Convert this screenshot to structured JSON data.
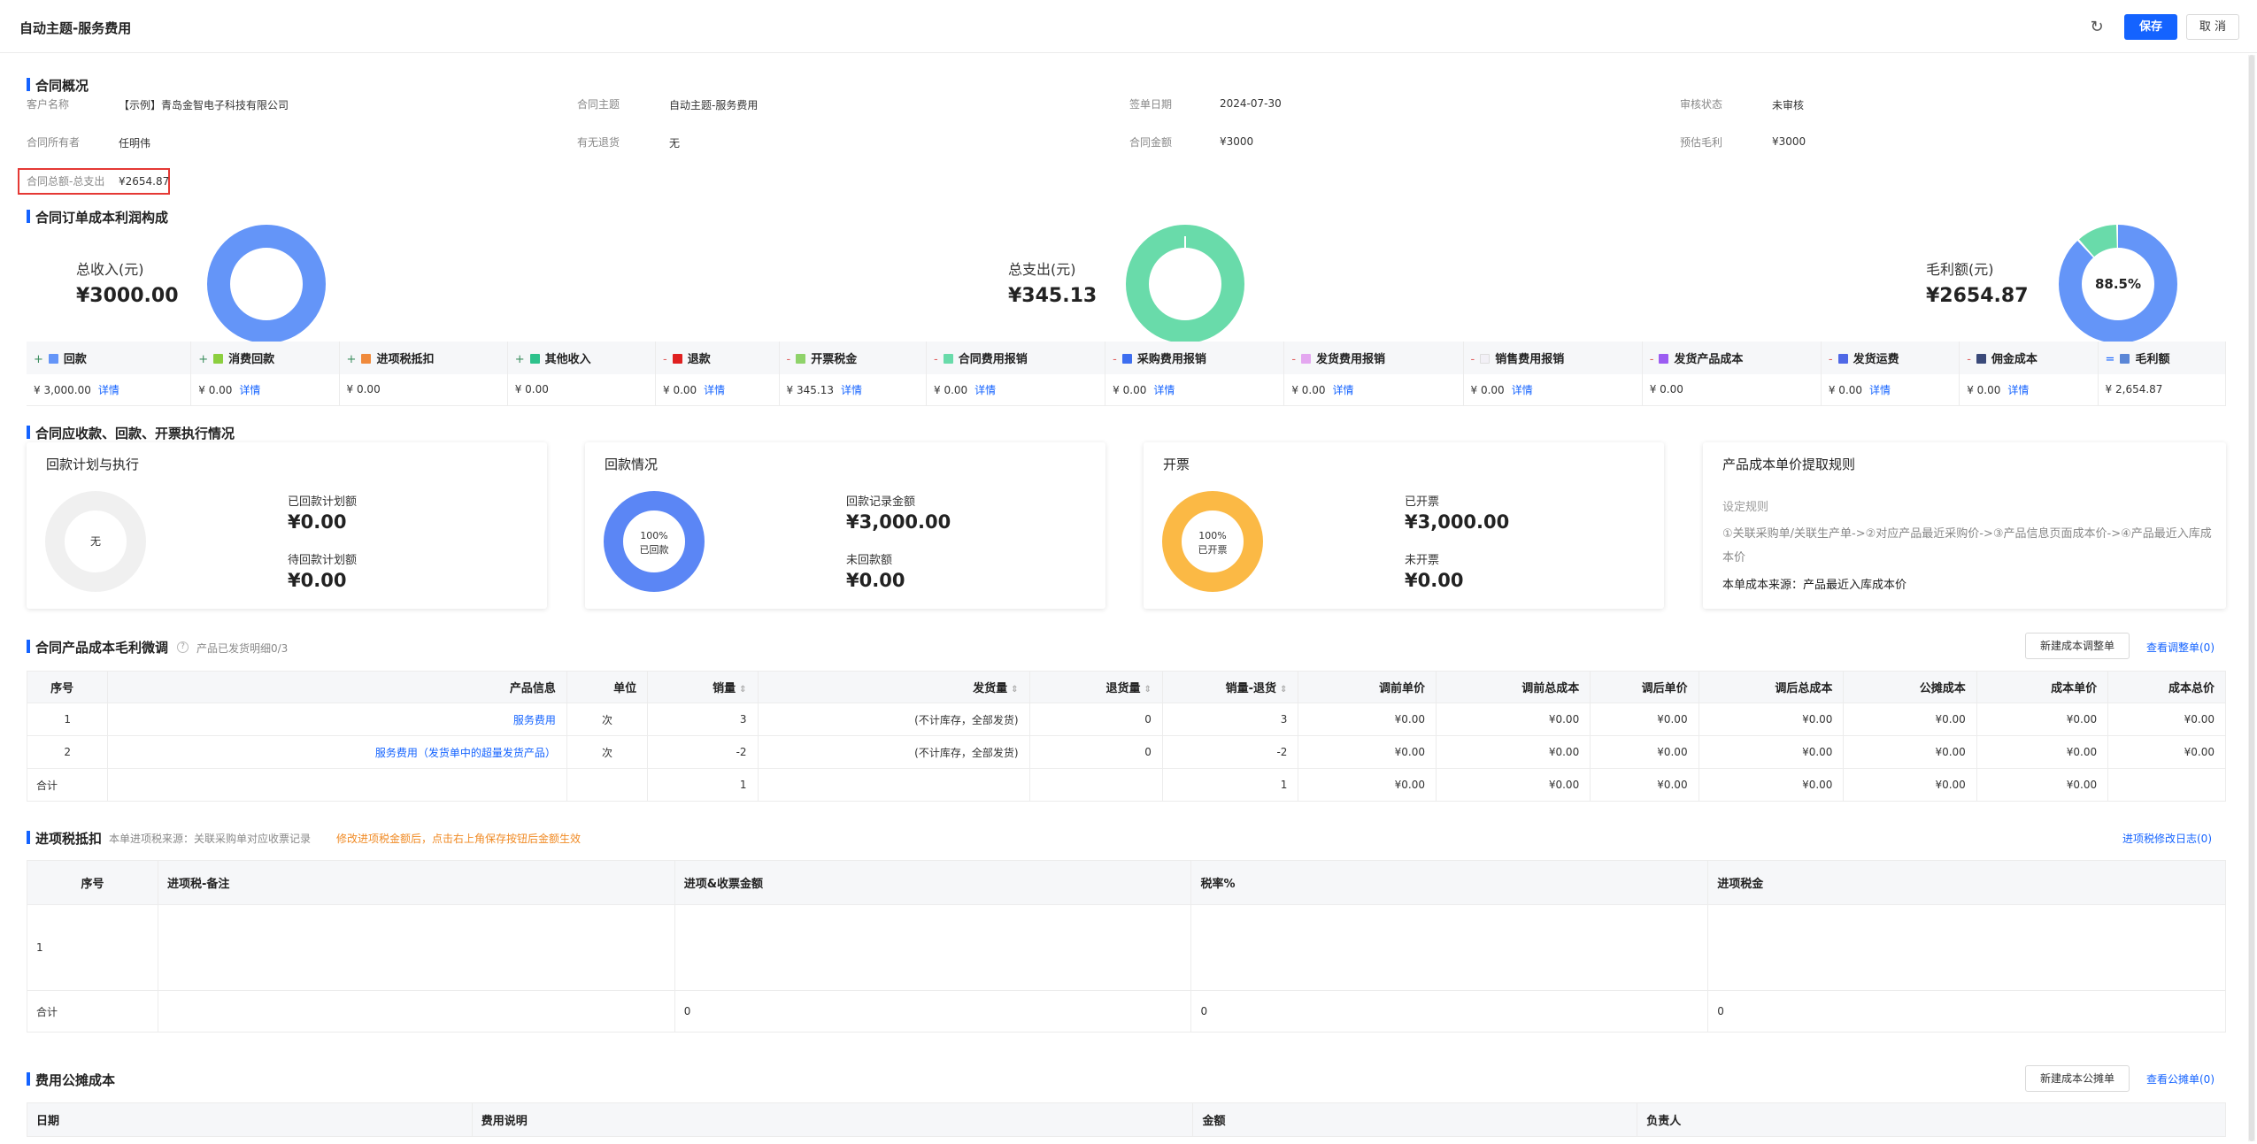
{
  "header": {
    "title": "自动主题-服务费用",
    "save_label": "保存",
    "cancel_label": "取 消",
    "refresh_icon": "refresh-icon"
  },
  "overview": {
    "title": "合同概况",
    "fields": [
      {
        "label": "客户名称",
        "value": "【示例】青岛金智电子科技有限公司"
      },
      {
        "label": "合同主题",
        "value": "自动主题-服务费用"
      },
      {
        "label": "签单日期",
        "value": "2024-07-30"
      },
      {
        "label": "审核状态",
        "value": "未审核"
      },
      {
        "label": "合同所有者",
        "value": "任明伟"
      },
      {
        "label": "有无退货",
        "value": "无"
      },
      {
        "label": "合同金额",
        "value": "¥3000"
      },
      {
        "label": "预估毛利",
        "value": "¥3000"
      }
    ],
    "highlight": {
      "label": "合同总额-总支出",
      "value": "¥2654.87"
    }
  },
  "cost_section": {
    "title": "合同订单成本利润构成",
    "rings": [
      {
        "label": "总收入(元)",
        "value": "¥3000.00",
        "color": "#6495f8",
        "segments": [
          {
            "fraction": 1.0,
            "color": "#6495f8"
          }
        ]
      },
      {
        "label": "总支出(元)",
        "value": "¥345.13",
        "color": "#69dbaa",
        "segments": [
          {
            "fraction": 1.0,
            "color": "#69dbaa"
          }
        ]
      },
      {
        "label": "毛利额(元)",
        "value": "¥2654.87",
        "center_text": "88.5%",
        "segments": [
          {
            "fraction": 0.885,
            "color": "#6495f8"
          },
          {
            "fraction": 0.115,
            "color": "#69dbaa"
          }
        ]
      }
    ],
    "summary": {
      "columns": [
        {
          "op": "+",
          "name": "回款",
          "color": "#6495f8",
          "value": "¥ 3,000.00",
          "link": "详情"
        },
        {
          "op": "+",
          "name": "消费回款",
          "color": "#8ccf3f",
          "value": "¥ 0.00",
          "link": "详情"
        },
        {
          "op": "+",
          "name": "进项税抵扣",
          "color": "#f08a3c",
          "value": "¥ 0.00",
          "link": ""
        },
        {
          "op": "+",
          "name": "其他收入",
          "color": "#2ec28c",
          "value": "¥ 0.00",
          "link": ""
        },
        {
          "op": "-",
          "name": "退款",
          "color": "#e02020",
          "value": "¥ 0.00",
          "link": "详情"
        },
        {
          "op": "-",
          "name": "开票税金",
          "color": "#8fd36a",
          "value": "¥ 345.13",
          "link": "详情"
        },
        {
          "op": "-",
          "name": "合同费用报销",
          "color": "#69dbaa",
          "value": "¥ 0.00",
          "link": "详情"
        },
        {
          "op": "-",
          "name": "采购费用报销",
          "color": "#3d6ef0",
          "value": "¥ 0.00",
          "link": "详情"
        },
        {
          "op": "-",
          "name": "发货费用报销",
          "color": "#e4a7f0",
          "value": "¥ 0.00",
          "link": "详情"
        },
        {
          "op": "-",
          "name": "销售费用报销",
          "color": "#f2f0f6",
          "value": "¥ 0.00",
          "link": "详情"
        },
        {
          "op": "-",
          "name": "发货产品成本",
          "color": "#9c5cf2",
          "value": "¥ 0.00",
          "link": ""
        },
        {
          "op": "-",
          "name": "发货运费",
          "color": "#4f68e6",
          "value": "¥ 0.00",
          "link": "详情"
        },
        {
          "op": "-",
          "name": "佣金成本",
          "color": "#3b4a7a",
          "value": "¥ 0.00",
          "link": "详情"
        },
        {
          "op": "=",
          "name": "毛利额",
          "color": "#5a86d6",
          "value": "¥ 2,654.87",
          "link": ""
        }
      ]
    }
  },
  "receivable_section": {
    "title": "合同应收款、回款、开票执行情况",
    "cards": [
      {
        "title": "回款计划与执行",
        "ring_text": "无",
        "ring_color": "#f0f0f0",
        "fraction": 1.0,
        "k1": "已回款计划额",
        "v1": "¥0.00",
        "k2": "待回款计划额",
        "v2": "¥0.00"
      },
      {
        "title": "回款情况",
        "ring_text": "100%",
        "ring_sub": "已回款",
        "ring_color": "#5b86f5",
        "fraction": 1.0,
        "k1": "回款记录金额",
        "v1": "¥3,000.00",
        "k2": "未回款额",
        "v2": "¥0.00"
      },
      {
        "title": "开票",
        "ring_text": "100%",
        "ring_sub": "已开票",
        "ring_color": "#fbb945",
        "fraction": 1.0,
        "k1": "已开票",
        "v1": "¥3,000.00",
        "k2": "未开票",
        "v2": "¥0.00"
      }
    ],
    "rule_card": {
      "title": "产品成本单价提取规则",
      "rule_label": "设定规则",
      "rule_text": "①关联采购单/关联生产单->②对应产品最近采购价->③产品信息页面成本价->④产品最近入库成本价",
      "source": "本单成本来源：产品最近入库成本价"
    }
  },
  "product_section": {
    "title": "合同产品成本毛利微调",
    "subtitle": "产品已发货明细0/3",
    "new_button": "新建成本调整单",
    "view_link": "查看调整单(0)",
    "columns": [
      "序号",
      "产品信息",
      "单位",
      "销量",
      "发货量",
      "退货量",
      "销量-退货",
      "调前单价",
      "调前总成本",
      "调后单价",
      "调后总成本",
      "公摊成本",
      "成本单价",
      "成本总价"
    ],
    "sortable": [
      false,
      false,
      false,
      true,
      true,
      true,
      true,
      false,
      false,
      false,
      false,
      false,
      false,
      false
    ],
    "rows": [
      [
        "1",
        "服务费用",
        "次",
        "3",
        "(不计库存，全部发货)",
        "0",
        "3",
        "¥0.00",
        "¥0.00",
        "¥0.00",
        "¥0.00",
        "¥0.00",
        "¥0.00",
        "¥0.00"
      ],
      [
        "2",
        "服务费用（发货单中的超量发货产品）",
        "次",
        "-2",
        "(不计库存，全部发货)",
        "0",
        "-2",
        "¥0.00",
        "¥0.00",
        "¥0.00",
        "¥0.00",
        "¥0.00",
        "¥0.00",
        "¥0.00"
      ]
    ],
    "total": [
      "合计",
      "",
      "",
      "1",
      "",
      "",
      "1",
      "¥0.00",
      "¥0.00",
      "¥0.00",
      "¥0.00",
      "¥0.00",
      "¥0.00",
      ""
    ]
  },
  "tax_section": {
    "title": "进项税抵扣",
    "subtitle": "本单进项税来源：关联采购单对应收票记录",
    "warning": "修改进项税金额后，点击右上角保存按钮后金额生效",
    "log_link": "进项税修改日志(0)",
    "columns": [
      "序号",
      "进项税-备注",
      "进项&收票金额",
      "税率%",
      "进项税金"
    ],
    "rows": [
      [
        "1",
        "",
        "",
        "",
        ""
      ]
    ],
    "total": [
      "合计",
      "",
      "0",
      "0",
      "0"
    ]
  },
  "fee_section": {
    "title": "费用公摊成本",
    "new_button": "新建成本公摊单",
    "view_link": "查看公摊单(0)",
    "columns": [
      "日期",
      "费用说明",
      "金额",
      "负责人"
    ]
  }
}
